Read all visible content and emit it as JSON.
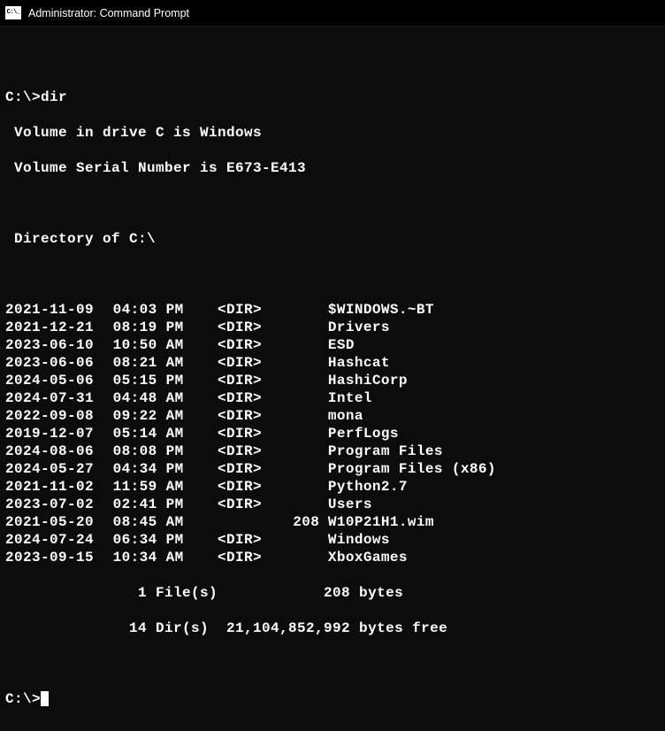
{
  "titlebar": {
    "text": "Administrator: Command Prompt"
  },
  "prompt": {
    "prefix": "C:\\>",
    "command": "dir"
  },
  "volume": {
    "line1": " Volume in drive C is Windows",
    "line2": " Volume Serial Number is E673-E413"
  },
  "directory_header": " Directory of C:\\",
  "entries": [
    {
      "date": "2021-11-09",
      "time": "04:03 PM",
      "type": "<DIR>",
      "size": "",
      "name": "$WINDOWS.~BT"
    },
    {
      "date": "2021-12-21",
      "time": "08:19 PM",
      "type": "<DIR>",
      "size": "",
      "name": "Drivers"
    },
    {
      "date": "2023-06-10",
      "time": "10:50 AM",
      "type": "<DIR>",
      "size": "",
      "name": "ESD"
    },
    {
      "date": "2023-06-06",
      "time": "08:21 AM",
      "type": "<DIR>",
      "size": "",
      "name": "Hashcat"
    },
    {
      "date": "2024-05-06",
      "time": "05:15 PM",
      "type": "<DIR>",
      "size": "",
      "name": "HashiCorp"
    },
    {
      "date": "2024-07-31",
      "time": "04:48 AM",
      "type": "<DIR>",
      "size": "",
      "name": "Intel"
    },
    {
      "date": "2022-09-08",
      "time": "09:22 AM",
      "type": "<DIR>",
      "size": "",
      "name": "mona"
    },
    {
      "date": "2019-12-07",
      "time": "05:14 AM",
      "type": "<DIR>",
      "size": "",
      "name": "PerfLogs"
    },
    {
      "date": "2024-08-06",
      "time": "08:08 PM",
      "type": "<DIR>",
      "size": "",
      "name": "Program Files"
    },
    {
      "date": "2024-05-27",
      "time": "04:34 PM",
      "type": "<DIR>",
      "size": "",
      "name": "Program Files (x86)"
    },
    {
      "date": "2021-11-02",
      "time": "11:59 AM",
      "type": "<DIR>",
      "size": "",
      "name": "Python2.7"
    },
    {
      "date": "2023-07-02",
      "time": "02:41 PM",
      "type": "<DIR>",
      "size": "",
      "name": "Users"
    },
    {
      "date": "2021-05-20",
      "time": "08:45 AM",
      "type": "",
      "size": "208",
      "name": "W10P21H1.wim"
    },
    {
      "date": "2024-07-24",
      "time": "06:34 PM",
      "type": "<DIR>",
      "size": "",
      "name": "Windows"
    },
    {
      "date": "2023-09-15",
      "time": "10:34 AM",
      "type": "<DIR>",
      "size": "",
      "name": "XboxGames"
    }
  ],
  "summary": {
    "files": "               1 File(s)            208 bytes",
    "dirs": "              14 Dir(s)  21,104,852,992 bytes free"
  },
  "prompt_end": "C:\\>"
}
